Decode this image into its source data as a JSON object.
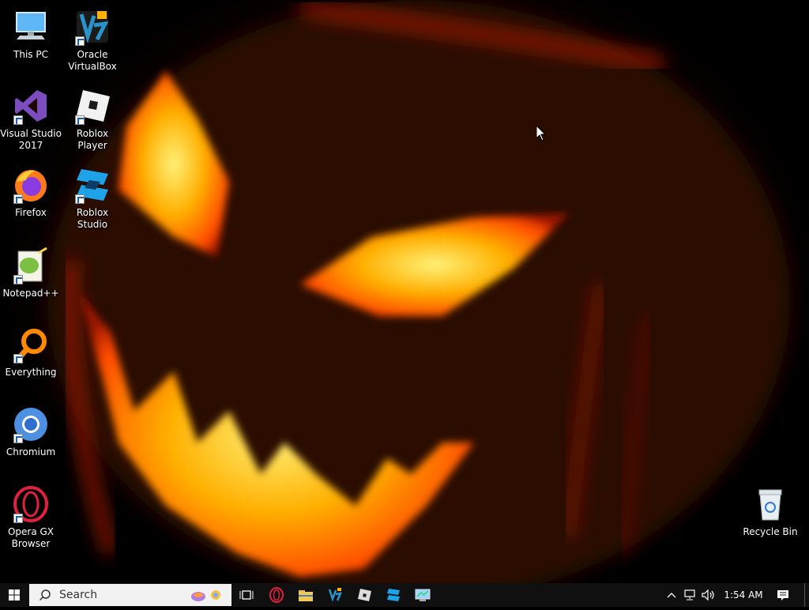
{
  "desktop_icons": {
    "this_pc": "This PC",
    "virtualbox": "Oracle VirtualBox",
    "visual_studio": "Visual Studio 2017",
    "roblox_player": "Roblox Player",
    "firefox": "Firefox",
    "roblox_studio": "Roblox Studio",
    "notepadpp": "Notepad++",
    "everything": "Everything",
    "chromium": "Chromium",
    "opera_gx": "Opera GX Browser",
    "recycle_bin": "Recycle Bin"
  },
  "taskbar": {
    "search_label": "Search",
    "time": "1:54 AM",
    "pinned": [
      "task-view-icon",
      "opera-icon",
      "file-explorer-icon",
      "virtualbox-icon",
      "roblox-player-icon",
      "roblox-studio-icon",
      "control-panel-icon"
    ],
    "tray": [
      "show-hidden-icons-icon",
      "network-icon",
      "volume-icon",
      "notification-icon"
    ]
  },
  "colors": {
    "taskbar_bg": "#101010",
    "search_bg": "#f2f2f2",
    "glow": "#ffb000"
  }
}
